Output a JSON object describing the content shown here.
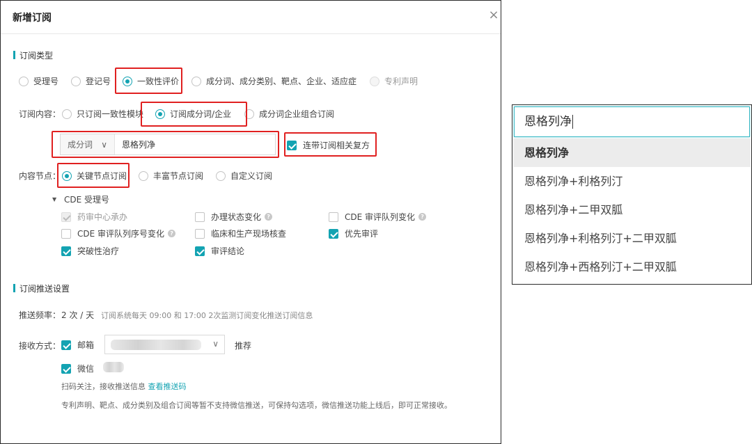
{
  "dialog": {
    "title": "新增订阅",
    "close_glyph": "×"
  },
  "sub_type": {
    "heading": "订阅类型",
    "options": [
      {
        "label": "受理号",
        "state": "off"
      },
      {
        "label": "登记号",
        "state": "off"
      },
      {
        "label": "一致性评价",
        "state": "on"
      },
      {
        "label": "成分词、成分类别、靶点、企业、适应症",
        "state": "off"
      },
      {
        "label": "专利声明",
        "state": "disabled"
      }
    ]
  },
  "content": {
    "label": "订阅内容：",
    "options": [
      {
        "label": "只订阅一致性模块",
        "state": "off"
      },
      {
        "label": "订阅成分词/企业",
        "state": "on"
      },
      {
        "label": "成分词企业组合订阅",
        "state": "off"
      }
    ],
    "select_value": "成分词",
    "select_chevron": "∨",
    "input_value": "恩格列净",
    "related_label": "连带订阅相关复方",
    "related_checked": true
  },
  "nodes": {
    "label": "内容节点：",
    "options": [
      {
        "label": "关键节点订阅",
        "state": "on"
      },
      {
        "label": "丰富节点订阅",
        "state": "off"
      },
      {
        "label": "自定义订阅",
        "state": "off"
      }
    ],
    "group_caret": "▼",
    "group_label": "CDE 受理号",
    "items": [
      {
        "label": "药审中心承办",
        "state": "disabled",
        "help": false
      },
      {
        "label": "办理状态变化",
        "state": "off",
        "help": true
      },
      {
        "label": "CDE 审评队列变化",
        "state": "off",
        "help": true
      },
      {
        "label": "CDE 审评队列序号变化",
        "state": "off",
        "help": true
      },
      {
        "label": "临床和生产现场核查",
        "state": "off",
        "help": false
      },
      {
        "label": "优先审评",
        "state": "on",
        "help": false
      },
      {
        "label": "突破性治疗",
        "state": "on",
        "help": false
      },
      {
        "label": "审评结论",
        "state": "on",
        "help": false
      }
    ],
    "help_glyph": "?"
  },
  "push": {
    "heading": "订阅推送设置",
    "freq_label": "推送频率：",
    "freq_value": "2 次 / 天",
    "freq_note": "订阅系统每天 09:00 和 17:00 2次监测订阅变化推送订阅信息",
    "receive_label": "接收方式：",
    "email_label": "邮箱",
    "email_checked": true,
    "email_chevron": "∨",
    "recommend": "推荐",
    "wechat_label": "微信",
    "wechat_checked": true,
    "scan_text": "扫码关注，接收推送信息",
    "scan_link": "查看推送码",
    "footnote": "专利声明、靶点、成分类别及组合订阅等暂不支持微信推送，可保持勾选项，微信推送功能上线后，即可正常接收。"
  },
  "autocomplete": {
    "query": "恩格列净",
    "suggestions": [
      "恩格列净",
      "恩格列净+利格列汀",
      "恩格列净+二甲双胍",
      "恩格列净+利格列汀+二甲双胍",
      "恩格列净+西格列汀+二甲双胍"
    ],
    "active_index": 0
  },
  "colors": {
    "accent": "#13a3b2",
    "highlight_box": "#e02020"
  }
}
